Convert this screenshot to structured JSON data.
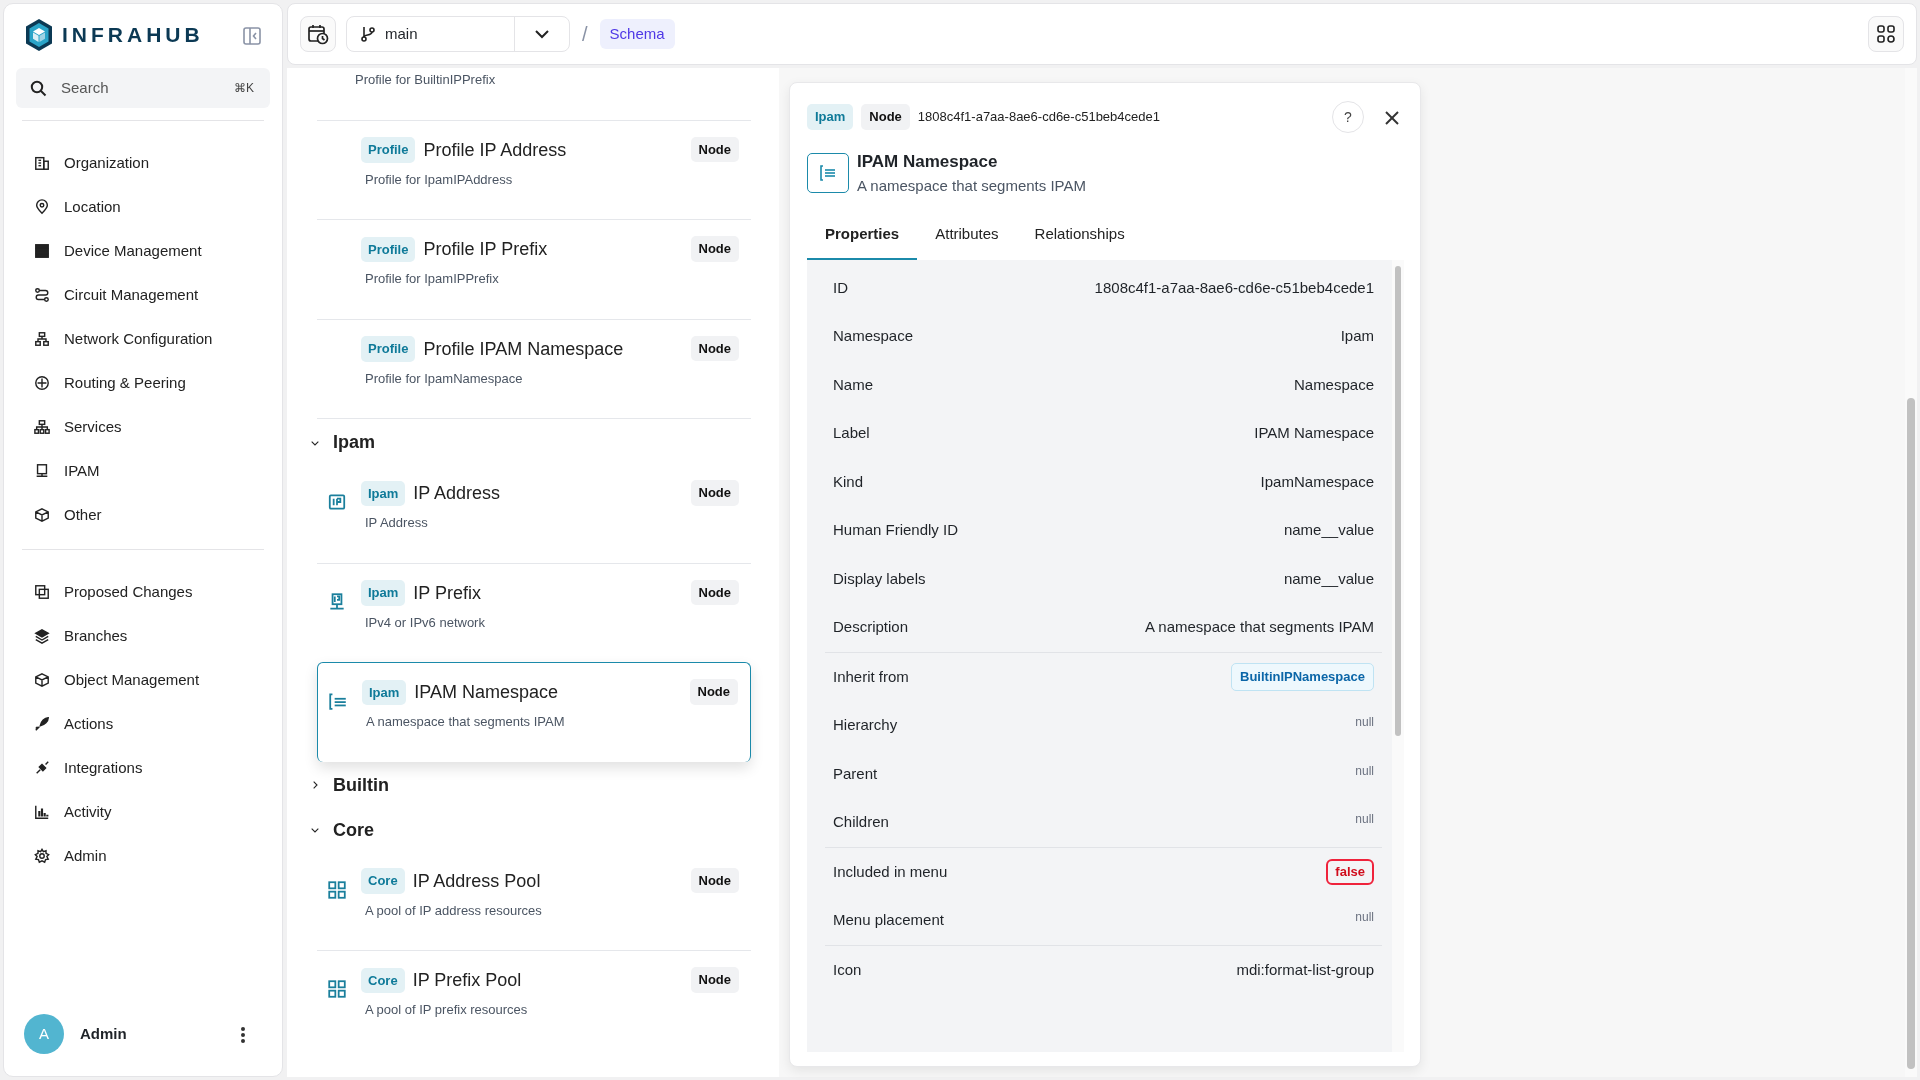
{
  "sidebar": {
    "brand": "INFRAHUB",
    "search": {
      "placeholder": "Search",
      "shortcut": "⌘K"
    },
    "menu": [
      {
        "label": "Organization"
      },
      {
        "label": "Location"
      },
      {
        "label": "Device Management"
      },
      {
        "label": "Circuit Management"
      },
      {
        "label": "Network Configuration"
      },
      {
        "label": "Routing & Peering"
      },
      {
        "label": "Services"
      },
      {
        "label": "IPAM"
      },
      {
        "label": "Other"
      }
    ],
    "menu_secondary": [
      {
        "label": "Proposed Changes"
      },
      {
        "label": "Branches"
      },
      {
        "label": "Object Management"
      },
      {
        "label": "Actions"
      },
      {
        "label": "Integrations"
      },
      {
        "label": "Activity"
      },
      {
        "label": "Admin"
      }
    ],
    "user": {
      "initial": "A",
      "name": "Admin"
    }
  },
  "topbar": {
    "branch": "main",
    "separator": "/",
    "breadcrumb": "Schema"
  },
  "schema_list": {
    "items": [
      {
        "kind": "partial",
        "description": "Profile for BuiltinIPPrefix"
      },
      {
        "kind": "profile",
        "namespace": "Profile",
        "label": "Profile IP Address",
        "description": "Profile for IpamIPAddress",
        "type": "Node",
        "selected": false
      },
      {
        "kind": "profile",
        "namespace": "Profile",
        "label": "Profile IP Prefix",
        "description": "Profile for IpamIPPrefix",
        "type": "Node",
        "selected": false
      },
      {
        "kind": "profile",
        "namespace": "Profile",
        "label": "Profile IPAM Namespace",
        "description": "Profile for IpamNamespace",
        "type": "Node",
        "selected": false
      }
    ],
    "groups": [
      {
        "label": "Ipam",
        "expanded": true,
        "items": [
          {
            "kind": "address",
            "namespace": "Ipam",
            "label": "IP Address",
            "description": "IP Address",
            "type": "Node",
            "selected": false
          },
          {
            "kind": "prefix",
            "namespace": "Ipam",
            "label": "IP Prefix",
            "description": "IPv4 or IPv6 network",
            "type": "Node",
            "selected": false
          },
          {
            "kind": "namespace",
            "namespace": "Ipam",
            "label": "IPAM Namespace",
            "description": "A namespace that segments IPAM",
            "type": "Node",
            "selected": true
          }
        ]
      },
      {
        "label": "Builtin",
        "expanded": false
      },
      {
        "label": "Core",
        "expanded": true,
        "items": [
          {
            "kind": "pool",
            "namespace": "Core",
            "label": "IP Address Pool",
            "description": "A pool of IP address resources",
            "type": "Node",
            "selected": false
          },
          {
            "kind": "pool",
            "namespace": "Core",
            "label": "IP Prefix Pool",
            "description": "A pool of IP prefix resources",
            "type": "Node",
            "selected": false
          }
        ]
      }
    ]
  },
  "detail": {
    "namespace": "Ipam",
    "type": "Node",
    "id": "1808c4f1-a7aa-8ae6-cd6e-c51beb4cede1",
    "help": "?",
    "title": "IPAM Namespace",
    "description": "A namespace that segments IPAM",
    "tabs": [
      {
        "label": "Properties",
        "selected": true
      },
      {
        "label": "Attributes",
        "selected": false
      },
      {
        "label": "Relationships",
        "selected": false
      }
    ],
    "sections": [
      [
        {
          "label": "ID",
          "kind": "text",
          "value": "1808c4f1-a7aa-8ae6-cd6e-c51beb4cede1"
        },
        {
          "label": "Namespace",
          "kind": "text",
          "value": "Ipam"
        },
        {
          "label": "Name",
          "kind": "text",
          "value": "Namespace"
        },
        {
          "label": "Label",
          "kind": "text",
          "value": "IPAM Namespace"
        },
        {
          "label": "Kind",
          "kind": "text",
          "value": "IpamNamespace"
        },
        {
          "label": "Human Friendly ID",
          "kind": "text",
          "value": "name__value"
        },
        {
          "label": "Display labels",
          "kind": "text",
          "value": "name__value"
        },
        {
          "label": "Description",
          "kind": "text",
          "value": "A namespace that segments IPAM"
        }
      ],
      [
        {
          "label": "Inherit from",
          "kind": "link",
          "value": "BuiltinIPNamespace"
        },
        {
          "label": "Hierarchy",
          "kind": "null",
          "value": "null"
        },
        {
          "label": "Parent",
          "kind": "null",
          "value": "null"
        },
        {
          "label": "Children",
          "kind": "null",
          "value": "null"
        }
      ],
      [
        {
          "label": "Included in menu",
          "kind": "bool",
          "on": false,
          "value": "false"
        },
        {
          "label": "Menu placement",
          "kind": "null",
          "value": "null"
        }
      ],
      [
        {
          "label": "Icon",
          "kind": "text",
          "value": "mdi:format-list-group"
        }
      ]
    ]
  }
}
